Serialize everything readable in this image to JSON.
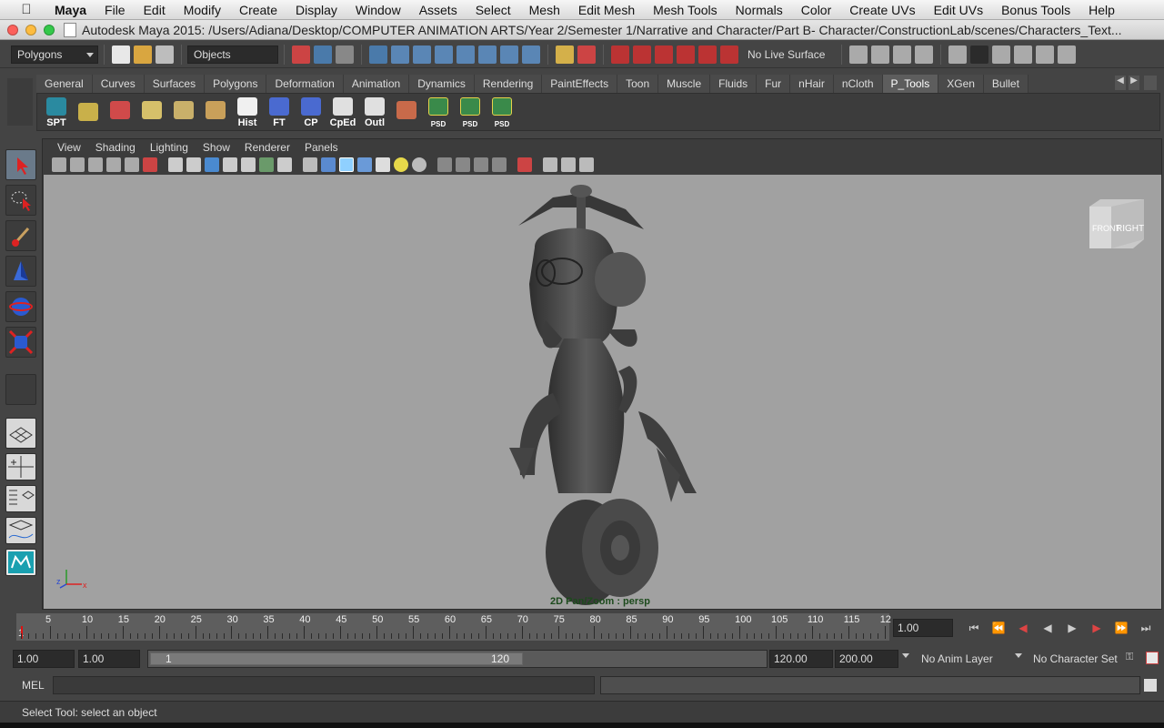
{
  "menubar": {
    "apple": "",
    "items": [
      "Maya",
      "File",
      "Edit",
      "Modify",
      "Create",
      "Display",
      "Window",
      "Assets",
      "Select",
      "Mesh",
      "Edit Mesh",
      "Mesh Tools",
      "Normals",
      "Color",
      "Create UVs",
      "Edit UVs",
      "Bonus Tools",
      "Help"
    ]
  },
  "window": {
    "title": "Autodesk Maya 2015: /Users/Adiana/Desktop/COMPUTER ANIMATION ARTS/Year 2/Semester 1/Narrative and Character/Part B- Character/ConstructionLab/scenes/Characters_Text..."
  },
  "statusline": {
    "mode": "Polygons",
    "selection_mask": "Objects",
    "live_surface": "No Live Surface"
  },
  "shelf": {
    "tabs": [
      "General",
      "Curves",
      "Surfaces",
      "Polygons",
      "Deformation",
      "Animation",
      "Dynamics",
      "Rendering",
      "PaintEffects",
      "Toon",
      "Muscle",
      "Fluids",
      "Fur",
      "nHair",
      "nCloth",
      "P_Tools",
      "XGen",
      "Bullet"
    ],
    "active_tab": "P_Tools",
    "buttons": [
      "SPT",
      "",
      "",
      "",
      "",
      "",
      "Hist",
      "FT",
      "CP",
      "CpEd",
      "Outl",
      "",
      "PSD",
      "PSD",
      "PSD"
    ]
  },
  "panel": {
    "menus": [
      "View",
      "Shading",
      "Lighting",
      "Show",
      "Renderer",
      "Panels"
    ],
    "camera_label": "2D Pan/Zoom : persp",
    "viewcube": {
      "front": "FRONT",
      "right": "RIGHT"
    },
    "axis": {
      "y": "y",
      "z": "z",
      "x": "x"
    }
  },
  "timeline": {
    "start_label": "1",
    "ticks": [
      "5",
      "10",
      "15",
      "20",
      "25",
      "30",
      "35",
      "40",
      "45",
      "50",
      "55",
      "60",
      "65",
      "70",
      "75",
      "80",
      "85",
      "90",
      "95",
      "100",
      "105",
      "110",
      "115",
      "12"
    ],
    "current_frame": "1.00"
  },
  "range": {
    "start_time": "1.00",
    "playback_start": "1.00",
    "slider_start": "1",
    "slider_end": "120",
    "playback_end": "120.00",
    "end_time": "200.00",
    "anim_layer": "No Anim Layer",
    "character_set": "No Character Set"
  },
  "cmdline": {
    "label": "MEL"
  },
  "help": {
    "text": "Select Tool: select an object"
  },
  "colors": {
    "viewport": "#a1a1a1",
    "camera_label": "#1c4a1c",
    "active_tab": "#5d5d5d"
  }
}
